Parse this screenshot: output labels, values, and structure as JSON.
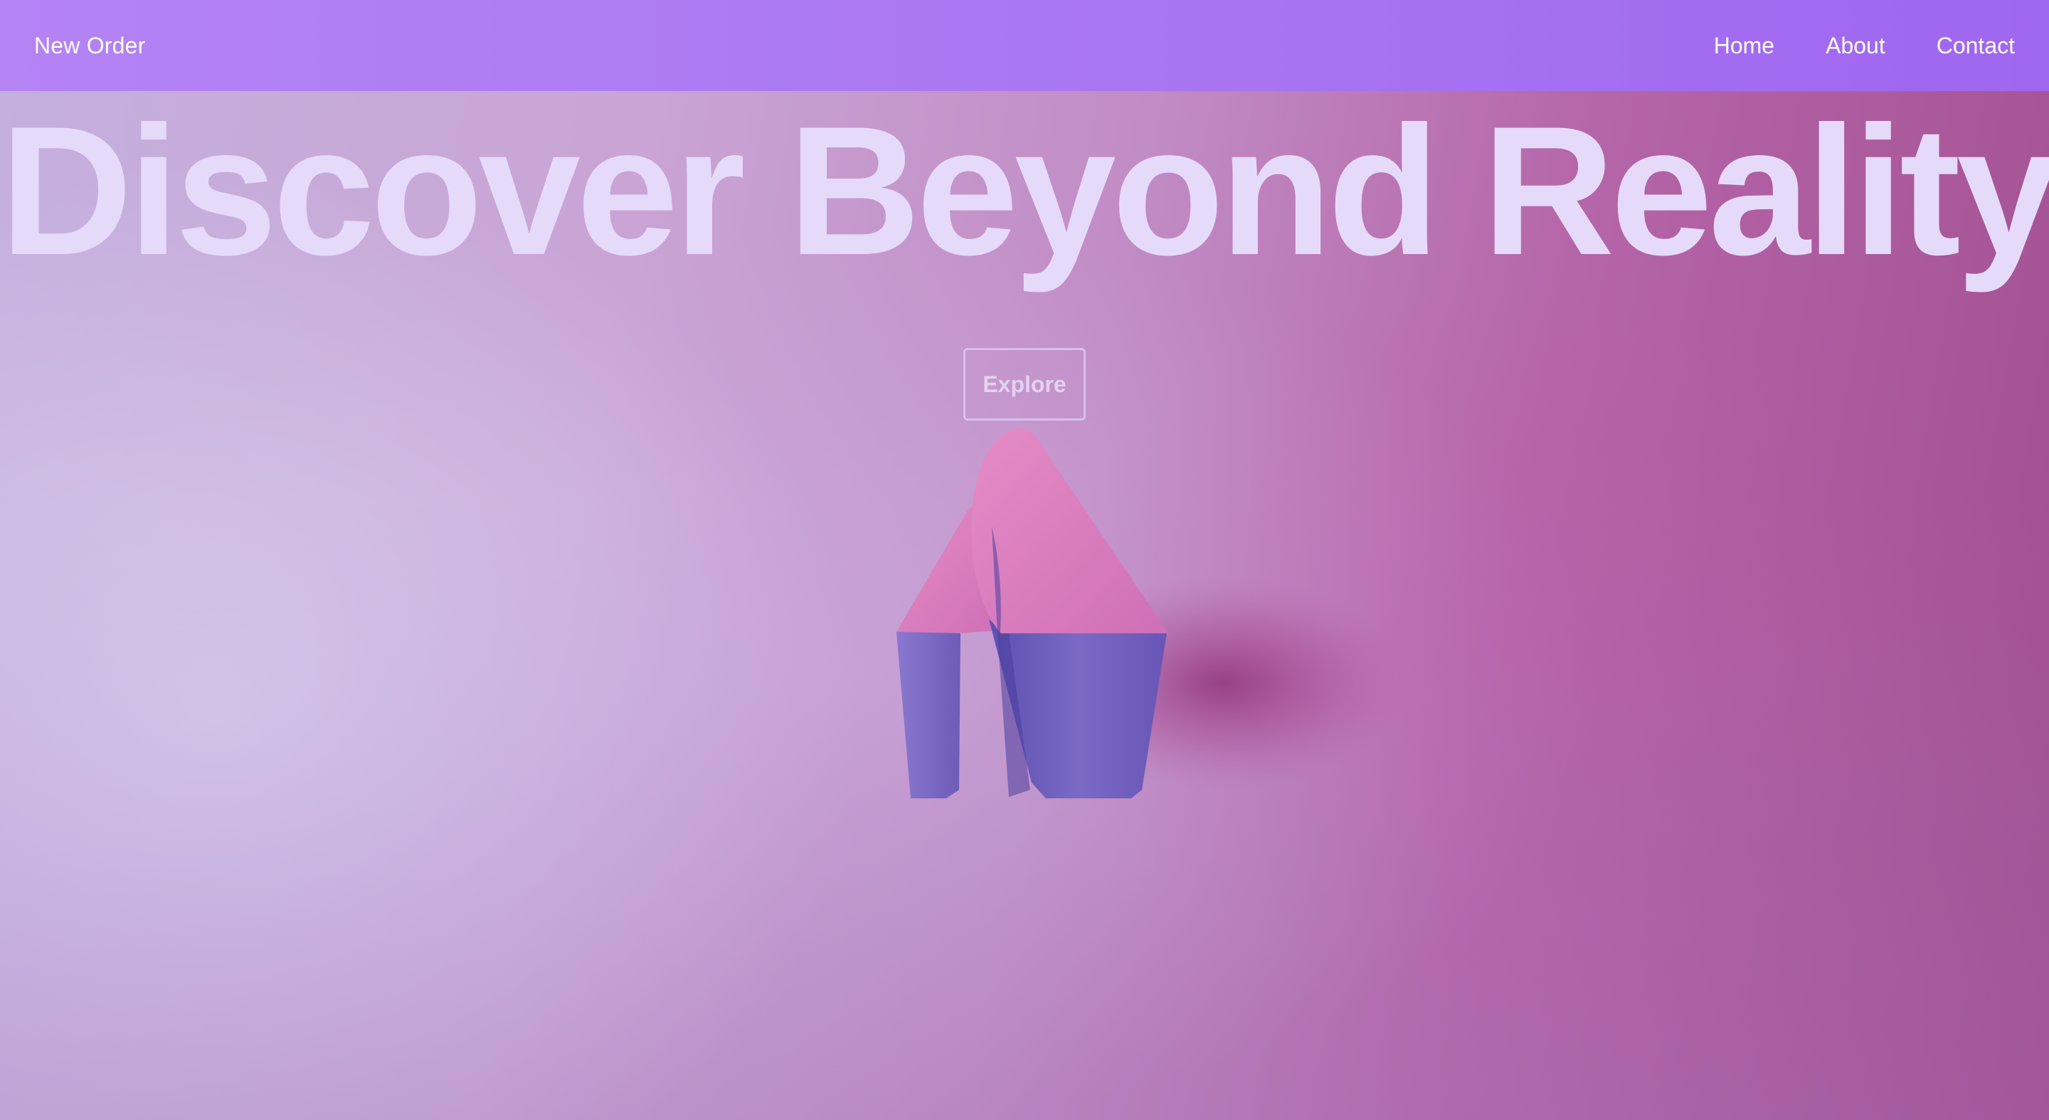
{
  "nav": {
    "brand": "New Order",
    "links": [
      "Home",
      "About",
      "Contact"
    ]
  },
  "hero": {
    "title": "Discover Beyond Reality",
    "cta_label": "Explore"
  },
  "icons": {
    "hero_art": "crystal-sculpture-icon"
  },
  "colors": {
    "nav_start": "#b483f4",
    "nav_end": "#9f66ef",
    "title": "#e6dafa",
    "background_left": "#c4b0dd",
    "background_right": "#a14e90",
    "sculpture_top": "#d978bd",
    "sculpture_side": "#7a68c4"
  }
}
